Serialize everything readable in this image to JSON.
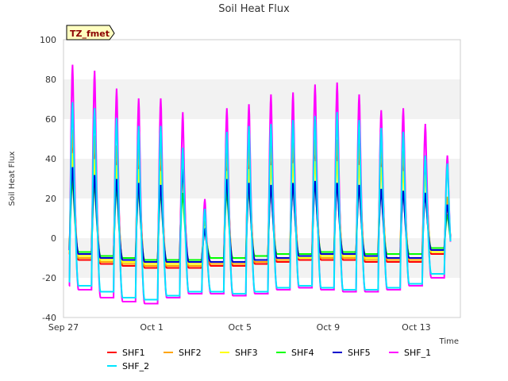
{
  "chart_data": {
    "type": "line",
    "title": "Soil Heat Flux",
    "xlabel": "Time",
    "ylabel": "Soil Heat Flux",
    "ylim": [
      -40,
      100
    ],
    "yticks": [
      "-40",
      "-20",
      "0",
      "20",
      "40",
      "60",
      "80",
      "100"
    ],
    "xlim_days": [
      0,
      18
    ],
    "xticks": [
      "Sep 27",
      "Oct 1",
      "Oct 5",
      "Oct 9",
      "Oct 13"
    ],
    "grid": "alternating horizontal bands",
    "tag": "TZ_fmet",
    "legend_position": "bottom",
    "dates": [
      "Sep 27",
      "Sep 28",
      "Sep 29",
      "Sep 30",
      "Oct 1",
      "Oct 2",
      "Oct 3",
      "Oct 4",
      "Oct 5",
      "Oct 6",
      "Oct 7",
      "Oct 8",
      "Oct 9",
      "Oct 10",
      "Oct 11",
      "Oct 12",
      "Oct 13",
      "Oct 14"
    ],
    "series": [
      {
        "name": "SHF1",
        "color": "#ff0000",
        "daily_max": [
          53,
          50,
          45,
          43,
          43,
          40,
          8,
          42,
          43,
          45,
          47,
          48,
          48,
          46,
          44,
          42,
          40,
          20
        ],
        "daily_min": [
          -8,
          -11,
          -13,
          -14,
          -15,
          -15,
          -15,
          -14,
          -14,
          -13,
          -12,
          -11,
          -11,
          -11,
          -12,
          -12,
          -12,
          -8
        ]
      },
      {
        "name": "SHF2",
        "color": "#ffa500",
        "daily_max": [
          55,
          52,
          47,
          45,
          45,
          42,
          9,
          44,
          45,
          47,
          49,
          50,
          50,
          48,
          46,
          44,
          42,
          21
        ],
        "daily_min": [
          -8,
          -10,
          -12,
          -13,
          -14,
          -14,
          -14,
          -13,
          -13,
          -12,
          -11,
          -10,
          -10,
          -10,
          -11,
          -11,
          -11,
          -7
        ]
      },
      {
        "name": "SHF3",
        "color": "#ffff00",
        "daily_max": [
          43,
          40,
          37,
          35,
          34,
          32,
          6,
          34,
          35,
          37,
          38,
          39,
          39,
          37,
          36,
          34,
          32,
          16
        ],
        "daily_min": [
          -7,
          -9,
          -11,
          -12,
          -13,
          -13,
          -13,
          -12,
          -12,
          -11,
          -10,
          -10,
          -9,
          -9,
          -10,
          -10,
          -10,
          -7
        ]
      },
      {
        "name": "SHF4",
        "color": "#00ff00",
        "daily_max": [
          30,
          28,
          26,
          25,
          24,
          23,
          4,
          24,
          25,
          26,
          27,
          28,
          28,
          26,
          25,
          24,
          23,
          12
        ],
        "daily_min": [
          -5,
          -7,
          -9,
          -10,
          -11,
          -11,
          -11,
          -10,
          -10,
          -9,
          -8,
          -8,
          -7,
          -7,
          -8,
          -8,
          -8,
          -5
        ]
      },
      {
        "name": "SHF5",
        "color": "#0000cd",
        "daily_max": [
          36,
          32,
          30,
          28,
          27,
          35,
          4,
          30,
          28,
          27,
          28,
          29,
          28,
          27,
          25,
          24,
          23,
          17
        ],
        "daily_min": [
          -6,
          -8,
          -10,
          -11,
          -12,
          -12,
          -12,
          -12,
          -12,
          -11,
          -10,
          -9,
          -8,
          -8,
          -9,
          -10,
          -10,
          -6
        ]
      },
      {
        "name": "SHF_1",
        "color": "#ff00ff",
        "daily_max": [
          88,
          85,
          76,
          71,
          71,
          64,
          20,
          66,
          68,
          73,
          74,
          78,
          79,
          73,
          65,
          66,
          58,
          42
        ],
        "daily_min": [
          -24,
          -26,
          -30,
          -32,
          -33,
          -30,
          -28,
          -28,
          -29,
          -28,
          -26,
          -25,
          -26,
          -27,
          -27,
          -26,
          -24,
          -20
        ]
      },
      {
        "name": "SHF_2",
        "color": "#00e5ff",
        "daily_max": [
          69,
          66,
          61,
          57,
          57,
          46,
          15,
          54,
          57,
          58,
          60,
          62,
          64,
          60,
          56,
          54,
          42,
          38
        ],
        "daily_min": [
          -22,
          -24,
          -27,
          -30,
          -31,
          -29,
          -27,
          -27,
          -28,
          -27,
          -25,
          -24,
          -25,
          -26,
          -26,
          -25,
          -23,
          -18
        ]
      }
    ]
  }
}
